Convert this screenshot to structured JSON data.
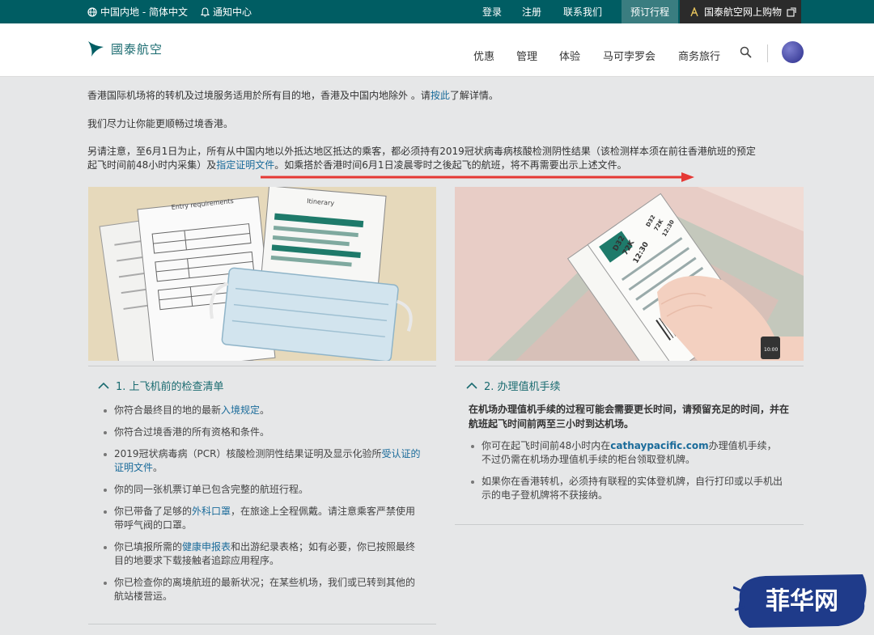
{
  "topbar": {
    "region": "中国内地 - 简体中文",
    "notifications": "通知中心",
    "login": "登录",
    "register": "注册",
    "contact": "联系我们",
    "manage_booking": "预订行程",
    "shop": "国泰航空网上购物"
  },
  "header": {
    "logo_text": "國泰航空",
    "nav": [
      "优惠",
      "管理",
      "体验",
      "马可孛罗会",
      "商务旅行"
    ]
  },
  "intro": {
    "line1_pre": "香港国际机场将的转机及过境服务适用於所有目的地，香港及中国内地除外 。请",
    "line1_link": "按此",
    "line1_post": "了解详情。",
    "line2": "我们尽力让你能更顺畅过境香港。",
    "line3a": "另请注意，至6月1日为止，所有从中国内地以外抵达地区抵达的乘客，都必须持有2019冠状病毒病核酸检测阴性结果（该检测样本须在前往香港航班的预定",
    "line3b_pre": "起飞时间前48小时内采集）及",
    "line3b_link": "指定证明文件",
    "line3b_post": "。如乘搭於香港时间6月1日凌晨零时之後起飞的航班，将不再需要出示上述文件。"
  },
  "left_image": {
    "doc1_title": "Entry requirements",
    "doc2_title": "Itinerary"
  },
  "right_image": {
    "pass1": [
      "D32",
      "72K",
      "12:30"
    ],
    "pass2": [
      "D32",
      "72K",
      "12:30"
    ],
    "watch": "10:00"
  },
  "section1": {
    "title": "1. 上飞机前的检查清单",
    "items": [
      {
        "pre": "你符合最终目的地的最新",
        "link": "入境规定",
        "post": "。"
      },
      {
        "pre": "你符合过境香港的所有资格和条件。",
        "link": "",
        "post": ""
      },
      {
        "pre": "2019冠状病毒病（PCR）核酸检测阴性结果证明及显示化验所",
        "link": "受认证的证明文件",
        "post": "。"
      },
      {
        "pre": "你的同一张机票订单已包含完整的航班行程。",
        "link": "",
        "post": ""
      },
      {
        "pre": "你已带备了足够的",
        "link": "外科口罩",
        "post": "，在旅途上全程佩戴。请注意乘客严禁使用带呼气阀的口罩。"
      },
      {
        "pre": "你已填报所需的",
        "link": "健康申报表",
        "post": "和出游纪录表格；如有必要，你已按照最终目的地要求下载接触者追踪应用程序。"
      },
      {
        "pre": "你已检查你的离境航班的最新状况；在某些机场，我们或已转到其他的航站楼营运。",
        "link": "",
        "post": ""
      }
    ]
  },
  "section2": {
    "title": "2. 办理值机手续",
    "intro": "在机场办理值机手续的过程可能会需要更长时间，请预留充足的时间，并在航班起飞时间前两至三小时到达机场。",
    "items": [
      {
        "pre": "你可在起飞时间前48小时内在",
        "link": "cathaypacific.com",
        "post": "办理值机手续，不过仍需在机场办理值机手续的柜台领取登机牌。"
      },
      {
        "pre": "如果你在香港转机，必须持有联程的实体登机牌，自行打印或以手机出示的电子登机牌将不获接纳。",
        "link": "",
        "post": ""
      }
    ]
  },
  "watermark": {
    "text": "菲华网"
  }
}
